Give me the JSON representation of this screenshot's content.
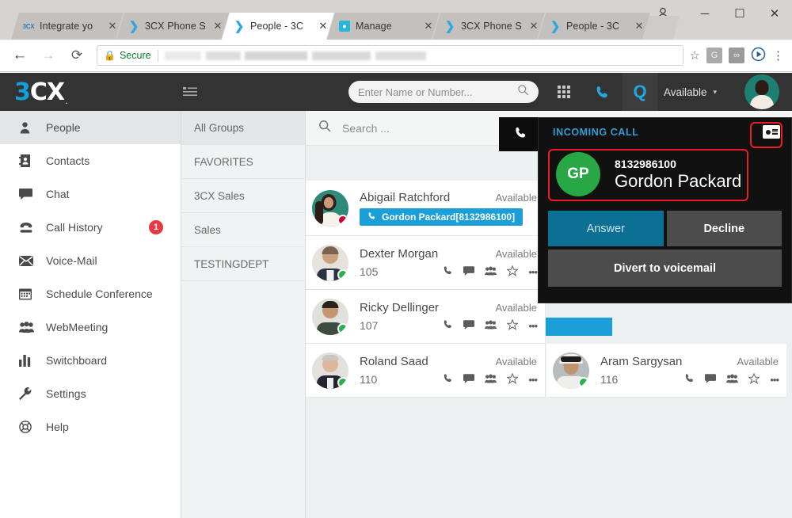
{
  "browser": {
    "tabs": [
      {
        "label": "Integrate yo",
        "favicon": "3cx-small-icon",
        "active": false
      },
      {
        "label": "3CX Phone S",
        "favicon": "3cx-chevron-icon",
        "active": false
      },
      {
        "label": "People - 3C",
        "favicon": "3cx-chevron-icon",
        "active": true
      },
      {
        "label": "Manage",
        "favicon": "manage-icon",
        "active": false
      },
      {
        "label": "3CX Phone S",
        "favicon": "3cx-chevron-icon",
        "active": false
      },
      {
        "label": "People - 3C",
        "favicon": "3cx-chevron-icon",
        "active": false
      }
    ],
    "close_label": "✕",
    "window": {
      "minimize": "─",
      "maximize": "☐",
      "close": "✕",
      "profile": "profile-icon"
    },
    "nav": {
      "back": "←",
      "forward": "→",
      "reload": "⟳"
    },
    "omnibox": {
      "lock": "lock-icon",
      "secure_label": "Secure",
      "url": "",
      "placeholder": ""
    },
    "toolbar": {
      "bookmark": "☆",
      "ext_g_label": "G",
      "ext_2_label": "∞",
      "play_label": "▶",
      "menu_label": "⋮"
    }
  },
  "app_header": {
    "logo_3": "3",
    "logo_cx": "CX",
    "logo_dot": ".",
    "hamburger": "list-icon",
    "search": {
      "value": "",
      "placeholder": "Enter Name or Number...",
      "icon": "search-icon"
    },
    "grid_icon": "apps-grid-icon",
    "phone_icon": "phone-icon",
    "q_icon": "Q",
    "status_label": "Available",
    "status_caret": "▾",
    "avatar": "user-avatar"
  },
  "sidebar": {
    "items": [
      {
        "label": "People",
        "icon": "person-icon",
        "active": true,
        "badge": ""
      },
      {
        "label": "Contacts",
        "icon": "contacts-book-icon",
        "active": false,
        "badge": ""
      },
      {
        "label": "Chat",
        "icon": "chat-bubble-icon",
        "active": false,
        "badge": ""
      },
      {
        "label": "Call History",
        "icon": "telephone-icon",
        "active": false,
        "badge": "1"
      },
      {
        "label": "Voice-Mail",
        "icon": "envelope-icon",
        "active": false,
        "badge": ""
      },
      {
        "label": "Schedule Conference",
        "icon": "calendar-icon",
        "active": false,
        "badge": ""
      },
      {
        "label": "WebMeeting",
        "icon": "people-group-icon",
        "active": false,
        "badge": ""
      },
      {
        "label": "Switchboard",
        "icon": "bar-chart-icon",
        "active": false,
        "badge": ""
      },
      {
        "label": "Settings",
        "icon": "wrench-icon",
        "active": false,
        "badge": ""
      },
      {
        "label": "Help",
        "icon": "lifebuoy-icon",
        "active": false,
        "badge": ""
      }
    ]
  },
  "groups": {
    "items": [
      {
        "label": "All Groups",
        "active": true
      },
      {
        "label": "FAVORITES",
        "active": false
      },
      {
        "label": "3CX Sales",
        "active": false
      },
      {
        "label": "Sales",
        "active": false
      },
      {
        "label": "TESTINGDEPT",
        "active": false
      }
    ]
  },
  "contacts": {
    "search": {
      "value": "",
      "placeholder": "Search ...",
      "icon": "search-icon"
    },
    "action_icons": {
      "call": "phone-icon",
      "chat": "chat-bubble-icon",
      "conference": "people-group-icon",
      "favorite": "star-icon",
      "more": "•••"
    },
    "list": [
      {
        "name": "Abigail Ratchford",
        "status": "Available",
        "extension": "",
        "presence": "busy",
        "active_call_chip": "Gordon Packard[8132986100]",
        "chip_icon": "phone-icon",
        "highlighted": true
      },
      {
        "name": "Dexter Morgan",
        "status": "Available",
        "extension": "105",
        "presence": "on",
        "active_call_chip": "",
        "highlighted": false
      },
      {
        "name": "Ricky Dellinger",
        "status": "Available",
        "extension": "107",
        "presence": "on",
        "active_call_chip": "",
        "highlighted": false
      },
      {
        "name": "Roland Saad",
        "status": "Available",
        "extension": "110",
        "presence": "on",
        "active_call_chip": "",
        "highlighted": false
      },
      {
        "name": "Aram Sargysan",
        "status": "Available",
        "extension": "116",
        "presence": "on",
        "active_call_chip": "",
        "highlighted": false
      }
    ]
  },
  "incoming_call": {
    "strip_icon": "phone-icon",
    "title": "INCOMING CALL",
    "contact_card_icon": "contact-card-icon",
    "initials": "GP",
    "number": "8132986100",
    "name": "Gordon Packard",
    "answer_label": "Answer",
    "decline_label": "Decline",
    "divert_label": "Divert to voicemail"
  },
  "colors": {
    "brand_blue": "#12a0d7",
    "header_dark": "#333333",
    "panel_black": "#111111",
    "answer_blue": "#0c6f94",
    "decline_gray": "#4c4c4c",
    "presence_available": "#25b14b",
    "presence_busy": "#d6002a",
    "badge_red": "#e63946",
    "highlight_red": "#ee1c25",
    "chip_blue": "#1a9fd8"
  }
}
